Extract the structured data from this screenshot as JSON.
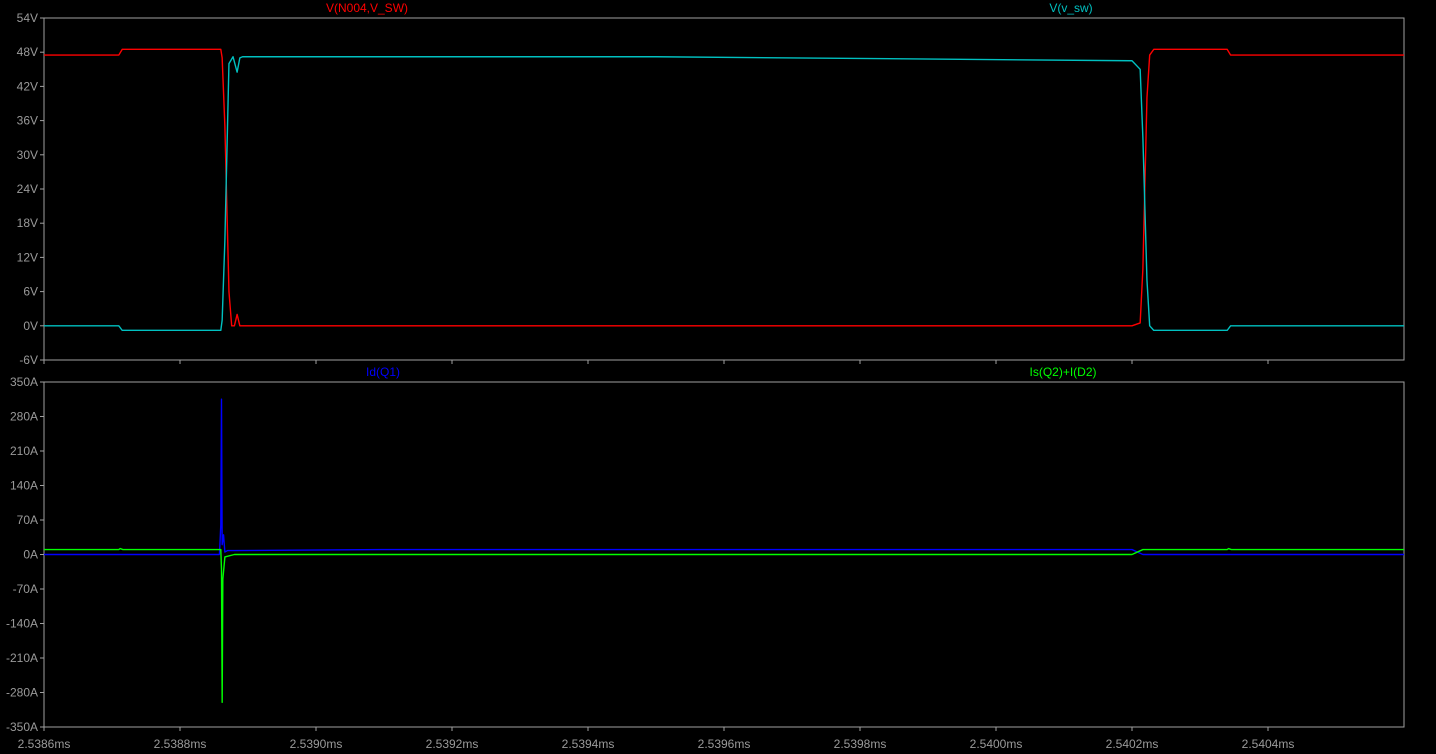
{
  "chart_data": [
    {
      "type": "line",
      "pane": "top",
      "xlim": [
        2.5386,
        2.5406
      ],
      "ylim": [
        -6,
        54
      ],
      "yticks": [
        -6,
        0,
        6,
        12,
        18,
        24,
        30,
        36,
        42,
        48,
        54
      ],
      "ytick_labels": [
        "-6V",
        "0V",
        "6V",
        "12V",
        "18V",
        "24V",
        "30V",
        "36V",
        "42V",
        "48V",
        "54V"
      ],
      "grid": false,
      "series": [
        {
          "name": "V(N004,V_SW)",
          "color": "#ff0000",
          "x": [
            2.5386,
            2.53871,
            2.538715,
            2.53886,
            2.538862,
            2.538866,
            2.538872,
            2.538876,
            2.53888,
            2.538884,
            2.538888,
            2.538892,
            2.539,
            2.5402,
            2.540212,
            2.540216,
            2.540222,
            2.540226,
            2.540232,
            2.54034,
            2.540345,
            2.5406
          ],
          "y": [
            47.5,
            47.5,
            48.5,
            48.5,
            47,
            35,
            6,
            0,
            0,
            2,
            0,
            0,
            0,
            0,
            0.5,
            10,
            40,
            47.5,
            48.5,
            48.5,
            47.5,
            47.5
          ]
        },
        {
          "name": "V(v_sw)",
          "color": "#00c0c0",
          "x": [
            2.5386,
            2.53871,
            2.538715,
            2.53886,
            2.538862,
            2.538866,
            2.538872,
            2.538878,
            2.538884,
            2.538888,
            2.538892,
            2.5395,
            2.5402,
            2.540212,
            2.540216,
            2.540222,
            2.540226,
            2.540232,
            2.54034,
            2.540345,
            2.5406
          ],
          "y": [
            0,
            0,
            -0.8,
            -0.8,
            1,
            15,
            46,
            47.2,
            44.5,
            47,
            47.2,
            47.2,
            46.5,
            45,
            33,
            8,
            0,
            -0.8,
            -0.8,
            0,
            0
          ]
        }
      ]
    },
    {
      "type": "line",
      "pane": "bottom",
      "xlim": [
        2.5386,
        2.5406
      ],
      "ylim": [
        -350,
        350
      ],
      "yticks": [
        -350,
        -280,
        -210,
        -140,
        -70,
        0,
        70,
        140,
        210,
        280,
        350
      ],
      "ytick_labels": [
        "-350A",
        "-280A",
        "-210A",
        "-140A",
        "-70A",
        "0A",
        "70A",
        "140A",
        "210A",
        "280A",
        "350A"
      ],
      "xticks": [
        2.5386,
        2.5388,
        2.539,
        2.5392,
        2.5394,
        2.5396,
        2.5398,
        2.54,
        2.5402,
        2.5404
      ],
      "xtick_labels": [
        "2.5386ms",
        "2.5388ms",
        "2.5390ms",
        "2.5392ms",
        "2.5394ms",
        "2.5396ms",
        "2.5398ms",
        "2.5400ms",
        "2.5402ms",
        "2.5404ms"
      ],
      "grid": false,
      "series": [
        {
          "name": "Id(Q1)",
          "color": "#0000ff",
          "x": [
            2.5386,
            2.538858,
            2.53886,
            2.538861,
            2.538862,
            2.538864,
            2.538866,
            2.53887,
            2.53888,
            2.5391,
            2.5402,
            2.540216,
            2.54023,
            2.5406
          ],
          "y": [
            0,
            0,
            60,
            315,
            20,
            40,
            5,
            8,
            8,
            10,
            10,
            0,
            0,
            0
          ]
        },
        {
          "name": "Is(Q2)+I(D2)",
          "color": "#00ff00",
          "x": [
            2.5386,
            2.53871,
            2.538712,
            2.538716,
            2.53886,
            2.538861,
            2.538862,
            2.538863,
            2.538866,
            2.53888,
            2.5402,
            2.540216,
            2.540225,
            2.54034,
            2.540342,
            2.540346,
            2.5406
          ],
          "y": [
            10,
            10,
            12,
            10,
            10,
            -30,
            -300,
            -50,
            -5,
            0,
            0,
            10,
            10,
            10,
            12,
            10,
            10
          ]
        }
      ]
    }
  ]
}
